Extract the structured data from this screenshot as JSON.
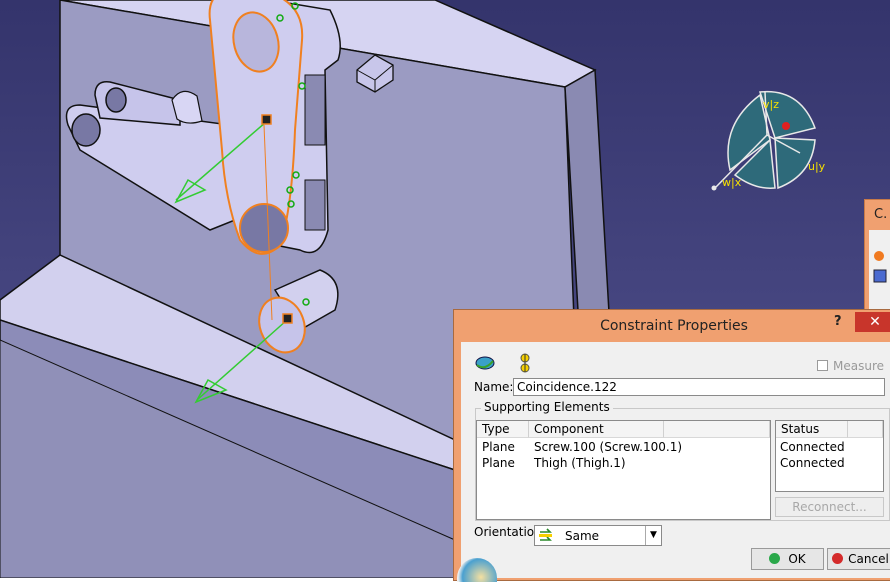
{
  "dialog": {
    "title": "Constraint Properties",
    "help_glyph": "?",
    "close_glyph": "✕",
    "measure_label": "Measure",
    "measure_checked": false,
    "name_label": "Name:",
    "name_value": "Coincidence.122",
    "supporting_elements_label": "Supporting Elements",
    "columns": [
      "Type",
      "Component",
      "Status"
    ],
    "rows": [
      {
        "type": "Plane",
        "component": "Screw.100 (Screw.100.1)",
        "status": "Connected"
      },
      {
        "type": "Plane",
        "component": "Thigh (Thigh.1)",
        "status": "Connected"
      }
    ],
    "reconnect_label": "Reconnect...",
    "orientation_label": "Orientation",
    "orientation_value": "Same",
    "ok_label": "OK",
    "cancel_label": "Cancel"
  },
  "compass": {
    "labels": {
      "z": "v|z",
      "y": "u|y",
      "x": "w|x"
    }
  },
  "ghost_panel_title": "C."
}
